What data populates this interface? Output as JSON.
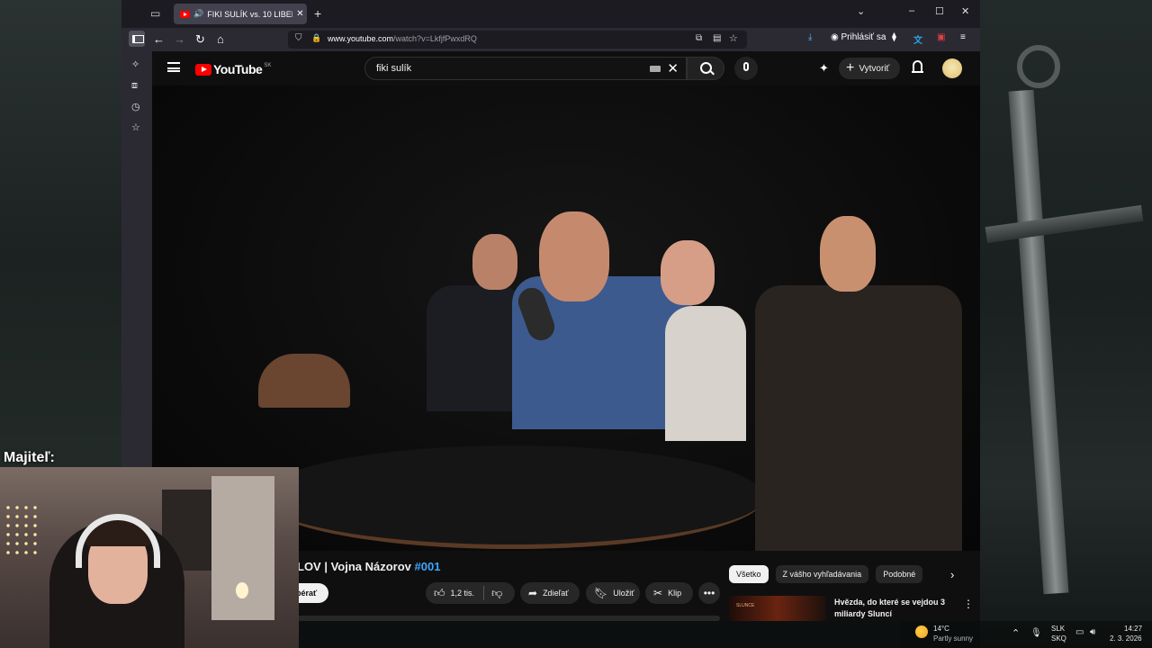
{
  "browser": {
    "tab_title": "FIKI SULÍK vs. 10 LIBERÁLOV",
    "url_domain": "www.youtube.com",
    "url_path": "/watch?v=LkfjfPwxdRQ",
    "signin_label": "Prihlásiť sa"
  },
  "youtube": {
    "logo_text": "YouTube",
    "logo_country": "SK",
    "search_value": "fiki sulík",
    "create_label": "Vytvoriť"
  },
  "video": {
    "title_visible": "LOV | Vojna Názorov ",
    "title_hashtag": "#001",
    "subscribe_label": "bérať",
    "like_count": "1,2 tis.",
    "share_label": "Zdieľať",
    "save_label": "Uložiť",
    "clip_label": "Klip"
  },
  "chips": [
    "Všetko",
    "Z vášho vyhľadávania",
    "Podobné"
  ],
  "recommendation": {
    "title": "Hvězda, do které se vejdou 3 miliardy Sluncí",
    "thumb_text": "SLUNCE"
  },
  "overlay": {
    "webcam_label": "Majiteľ:"
  },
  "taskbar": {
    "weather_temp": "14°C",
    "weather_desc": "Partly sunny",
    "lang_top": "SLK",
    "lang_bottom": "SKQ",
    "time": "14:27",
    "date": "2. 3. 2026"
  }
}
